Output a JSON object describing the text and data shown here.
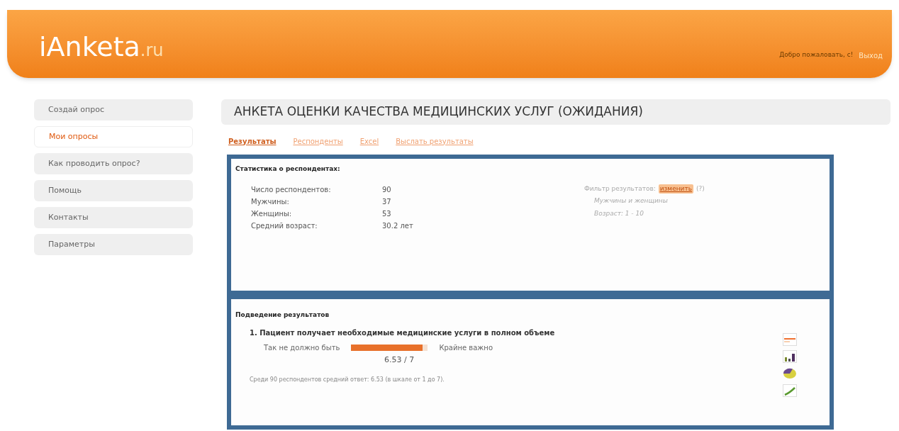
{
  "header": {
    "logo_main": "iAnketa",
    "logo_suffix": ".ru",
    "welcome": "Добро пожаловать, с!",
    "logout": "Выход"
  },
  "sidebar": {
    "items": [
      {
        "label": "Создай опрос",
        "selected": false
      },
      {
        "label": "Мои опросы",
        "selected": true
      },
      {
        "label": "Как проводить опрос?",
        "selected": false
      },
      {
        "label": "Помощь",
        "selected": false
      },
      {
        "label": "Контакты",
        "selected": false
      },
      {
        "label": "Параметры",
        "selected": false
      }
    ]
  },
  "page_title": "АНКЕТА ОЦЕНКИ КАЧЕСТВА МЕДИЦИНСКИХ УСЛУГ (ОЖИДАНИЯ)",
  "tabs": [
    {
      "label": "Результаты",
      "selected": true
    },
    {
      "label": "Респонденты",
      "selected": false
    },
    {
      "label": "Excel",
      "selected": false
    },
    {
      "label": "Выслать результаты",
      "selected": false
    }
  ],
  "stats": {
    "title": "Статистика о респондентах:",
    "rows": [
      {
        "label": "Число респондентов:",
        "value": "90"
      },
      {
        "label": "Мужчины:",
        "value": "37"
      },
      {
        "label": "Женщины:",
        "value": "53"
      },
      {
        "label": "Средний возраст:",
        "value": "30.2 лет"
      }
    ],
    "filter": {
      "label": "Фильтр результатов:",
      "link": "изменить",
      "hint": "(?)",
      "lines": [
        "Мужчины и женщины",
        "Возраст: 1 - 10"
      ]
    }
  },
  "summary": {
    "title": "Подведение результатов",
    "questions": [
      {
        "title": "1. Пациент получает необходимые медицинские услуги в полном объеме",
        "low_label": "Так не должно быть",
        "high_label": "Крайне важно",
        "level": 0.93,
        "score": "6.53 / 7",
        "note": "Среди 90 респондентов средний ответ: 6.53 (в шкале от 1 до 7)."
      }
    ]
  }
}
